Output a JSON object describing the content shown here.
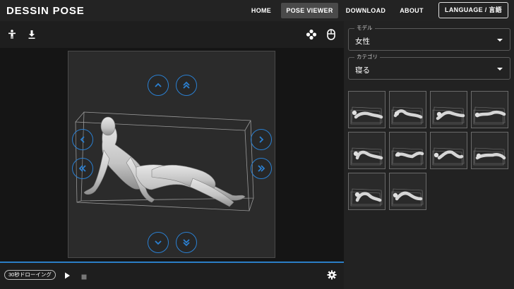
{
  "header": {
    "brand": "DESSIN POSE",
    "nav": {
      "home": "HOME",
      "pose_viewer": "POSE VIEWER",
      "download": "DOWNLOAD",
      "about": "ABOUT",
      "language": "LANGUAGE / 言語"
    }
  },
  "toolbar": {
    "icons": [
      "person-icon",
      "download-icon",
      "move-icon",
      "mouse-icon"
    ]
  },
  "viewer": {
    "controls": [
      "chevron-up-icon",
      "double-chevron-up-icon",
      "chevron-left-icon",
      "double-chevron-left-icon",
      "chevron-right-icon",
      "double-chevron-right-icon",
      "chevron-down-icon",
      "double-chevron-down-icon"
    ]
  },
  "bottom_bar": {
    "timer_label": "30秒ドローイング",
    "icons": [
      "play-icon",
      "stop-icon",
      "settings-icon"
    ]
  },
  "sidebar": {
    "model": {
      "label": "モデル",
      "value": "女性"
    },
    "category": {
      "label": "カテゴリ",
      "value": "寝る"
    },
    "thumbnail_count": 10
  },
  "colors": {
    "accent": "#2b80d2",
    "header_bg": "#232323",
    "viewer_bg": "#151515",
    "canvas_bg": "#2b2b2b",
    "sidebar_bg": "#222222"
  }
}
